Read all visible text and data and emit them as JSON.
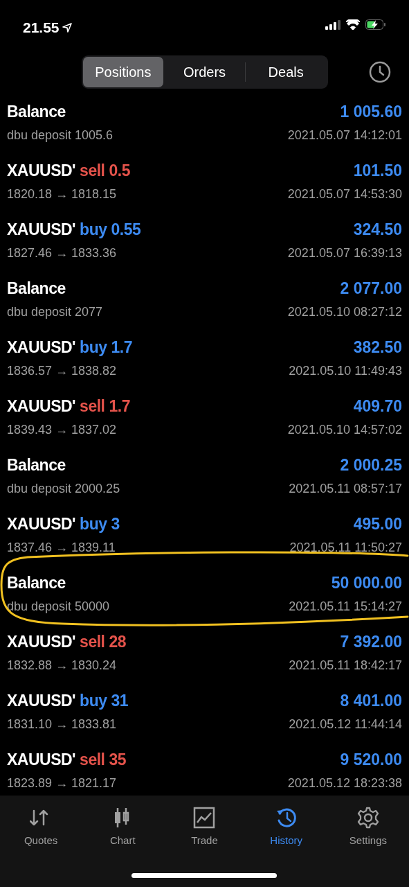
{
  "status_bar": {
    "time": "21.55"
  },
  "tabs": [
    {
      "label": "Positions",
      "selected": true
    },
    {
      "label": "Orders",
      "selected": false
    },
    {
      "label": "Deals",
      "selected": false
    }
  ],
  "rows": [
    {
      "kind": "balance",
      "title": "Balance",
      "detail": "dbu deposit 1005.6",
      "amount": "1 005.60",
      "time": "2021.05.07 14:12:01",
      "circled": false
    },
    {
      "kind": "trade",
      "title": "XAUUSD'",
      "side": "sell",
      "volume": "0.5",
      "detail": "1820.18 → 1818.15",
      "amount": "101.50",
      "time": "2021.05.07 14:53:30",
      "circled": false
    },
    {
      "kind": "trade",
      "title": "XAUUSD'",
      "side": "buy",
      "volume": "0.55",
      "detail": "1827.46 → 1833.36",
      "amount": "324.50",
      "time": "2021.05.07 16:39:13",
      "circled": false
    },
    {
      "kind": "balance",
      "title": "Balance",
      "detail": "dbu deposit 2077",
      "amount": "2 077.00",
      "time": "2021.05.10 08:27:12",
      "circled": false
    },
    {
      "kind": "trade",
      "title": "XAUUSD'",
      "side": "buy",
      "volume": "1.7",
      "detail": "1836.57 → 1838.82",
      "amount": "382.50",
      "time": "2021.05.10 11:49:43",
      "circled": false
    },
    {
      "kind": "trade",
      "title": "XAUUSD'",
      "side": "sell",
      "volume": "1.7",
      "detail": "1839.43 → 1837.02",
      "amount": "409.70",
      "time": "2021.05.10 14:57:02",
      "circled": false
    },
    {
      "kind": "balance",
      "title": "Balance",
      "detail": "dbu deposit 2000.25",
      "amount": "2 000.25",
      "time": "2021.05.11 08:57:17",
      "circled": false
    },
    {
      "kind": "trade",
      "title": "XAUUSD'",
      "side": "buy",
      "volume": "3",
      "detail": "1837.46 → 1839.11",
      "amount": "495.00",
      "time": "2021.05.11 11:50:27",
      "circled": false
    },
    {
      "kind": "balance",
      "title": "Balance",
      "detail": "dbu deposit 50000",
      "amount": "50 000.00",
      "time": "2021.05.11 15:14:27",
      "circled": true
    },
    {
      "kind": "trade",
      "title": "XAUUSD'",
      "side": "sell",
      "volume": "28",
      "detail": "1832.88 → 1830.24",
      "amount": "7 392.00",
      "time": "2021.05.11 18:42:17",
      "circled": false
    },
    {
      "kind": "trade",
      "title": "XAUUSD'",
      "side": "buy",
      "volume": "31",
      "detail": "1831.10 → 1833.81",
      "amount": "8 401.00",
      "time": "2021.05.12 11:44:14",
      "circled": false
    },
    {
      "kind": "trade",
      "title": "XAUUSD'",
      "side": "sell",
      "volume": "35",
      "detail": "1823.89 → 1821.17",
      "amount": "9 520.00",
      "time": "2021.05.12 18:23:38",
      "circled": false
    }
  ],
  "nav": [
    {
      "kind": "quotes",
      "label": "Quotes",
      "selected": false
    },
    {
      "kind": "chart",
      "label": "Chart",
      "selected": false
    },
    {
      "kind": "trade",
      "label": "Trade",
      "selected": false
    },
    {
      "kind": "history",
      "label": "History",
      "selected": true
    },
    {
      "kind": "settings",
      "label": "Settings",
      "selected": false
    }
  ]
}
